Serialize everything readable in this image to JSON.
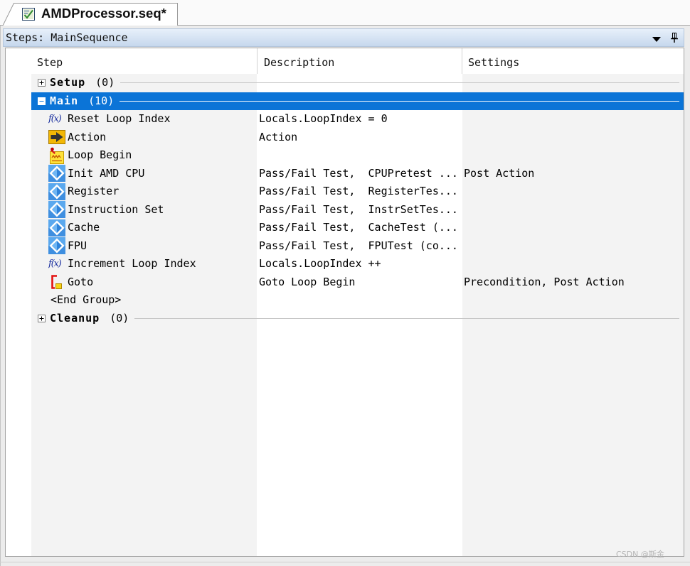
{
  "tab": {
    "title": "AMDProcessor.seq*",
    "icon": "sequence-file-icon"
  },
  "panel": {
    "title": "Steps: MainSequence",
    "icons": [
      "dropdown-arrow-icon",
      "pin-icon"
    ]
  },
  "columns": {
    "step": "Step",
    "description": "Description",
    "settings": "Settings"
  },
  "rows": [
    {
      "group": true,
      "name": "Setup",
      "count": "(0)",
      "expanded": false,
      "selected": false
    },
    {
      "group": true,
      "name": "Main",
      "count": "(10)",
      "expanded": true,
      "selected": true
    },
    {
      "icon": "function-icon",
      "glyph": "f(x)",
      "name": "Reset Loop Index",
      "description": "Locals.LoopIndex = 0"
    },
    {
      "icon": "action-icon",
      "name": "Action",
      "description": "Action"
    },
    {
      "icon": "loop-begin-icon",
      "name": "Loop Begin"
    },
    {
      "icon": "pass-fail-test-icon",
      "name": "Init AMD CPU",
      "description": "Pass/Fail Test,  CPUPretest ...",
      "settings": "Post Action"
    },
    {
      "icon": "pass-fail-test-icon",
      "name": "Register",
      "description": "Pass/Fail Test,  RegisterTes..."
    },
    {
      "icon": "pass-fail-test-icon",
      "name": "Instruction Set",
      "description": "Pass/Fail Test,  InstrSetTes..."
    },
    {
      "icon": "pass-fail-test-icon",
      "name": "Cache",
      "description": "Pass/Fail Test,  CacheTest (..."
    },
    {
      "icon": "pass-fail-test-icon",
      "name": "FPU",
      "description": "Pass/Fail Test,  FPUTest (co..."
    },
    {
      "icon": "function-icon",
      "glyph": "f(x)",
      "name": "Increment Loop Index",
      "description": "Locals.LoopIndex ++"
    },
    {
      "icon": "goto-icon",
      "name": "Goto",
      "description": "Goto Loop Begin",
      "settings": "Precondition, Post Action"
    },
    {
      "end_marker": true,
      "name": "<End Group>"
    },
    {
      "group": true,
      "name": "Cleanup",
      "count": "(0)",
      "expanded": false,
      "selected": false
    }
  ],
  "colors": {
    "selection": "#0b74d7",
    "shaded_column": "#f3f3f3"
  },
  "watermark": "CSDN @斯金"
}
